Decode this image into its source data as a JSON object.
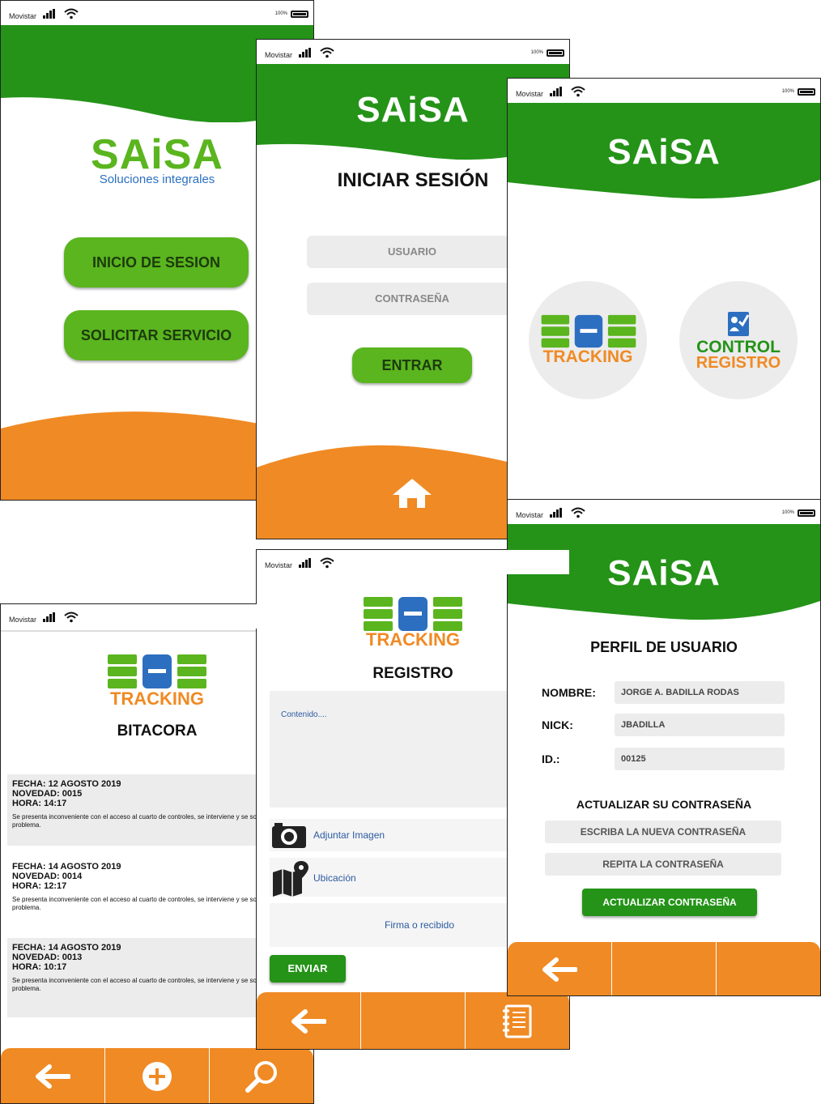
{
  "status": {
    "carrier": "Movistar",
    "battery": "100%"
  },
  "colors": {
    "green": "#249318",
    "light_green": "#5ab51e",
    "orange": "#f08a24",
    "gray": "#ececec"
  },
  "splash": {
    "logo": "SAiSA",
    "tagline": "Soluciones integrales",
    "login_btn": "INICIO DE SESION",
    "request_btn": "SOLICITAR SERVICIO"
  },
  "login": {
    "logo": "SAiSA",
    "title": "INICIAR SESIÓN",
    "user_placeholder": "USUARIO",
    "pass_placeholder": "CONTRASEÑA",
    "enter_btn": "ENTRAR",
    "home_icon": "home-icon"
  },
  "menu": {
    "logo": "SAiSA",
    "tracking_label": "TRACKING",
    "control_line1": "CONTROL",
    "control_line2": "REGISTRO"
  },
  "profile": {
    "logo": "SAiSA",
    "title": "PERFIL DE USUARIO",
    "name_label": "NOMBRE:",
    "name_value": "JORGE  A. BADILLA RODAS",
    "nick_label": "NICK:",
    "nick_value": "JBADILLA",
    "id_label": "ID.:",
    "id_value": "00125",
    "update_title": "ACTUALIZAR SU CONTRASEÑA",
    "new_pass_placeholder": "ESCRIBA LA NUEVA CONTRASEÑA",
    "repeat_pass_placeholder": "REPITA LA CONTRASEÑA",
    "update_btn": "ACTUALIZAR CONTRASEÑA"
  },
  "log": {
    "tracking_label": "TRACKING",
    "title": "BITACORA",
    "entries": [
      {
        "fecha": "FECHA: 12 AGOSTO 2019",
        "novedad": "NOVEDAD: 0015",
        "hora": "HORA: 14:17",
        "text": "Se presenta inconveniente con el acceso al cuarto de controles, se interviene y se soluciona el problema."
      },
      {
        "fecha": "FECHA: 14 AGOSTO 2019",
        "novedad": "NOVEDAD: 0014",
        "hora": "HORA: 12:17",
        "text": "Se presenta inconveniente con el acceso al cuarto de controles, se interviene y se soluciona el problema."
      },
      {
        "fecha": "FECHA: 14 AGOSTO 2019",
        "novedad": "NOVEDAD: 0013",
        "hora": "HORA: 10:17",
        "text": "Se presenta inconveniente con el acceso al cuarto de controles, se interviene y se soluciona el problema."
      }
    ]
  },
  "register": {
    "tracking_label": "TRACKING",
    "title": "REGISTRO",
    "content_placeholder": "Contenido....",
    "attach_label": "Adjuntar Imagen",
    "location_label": "Ubicación",
    "signature_label": "Firma o recibido",
    "send_btn": "ENVIAR"
  }
}
